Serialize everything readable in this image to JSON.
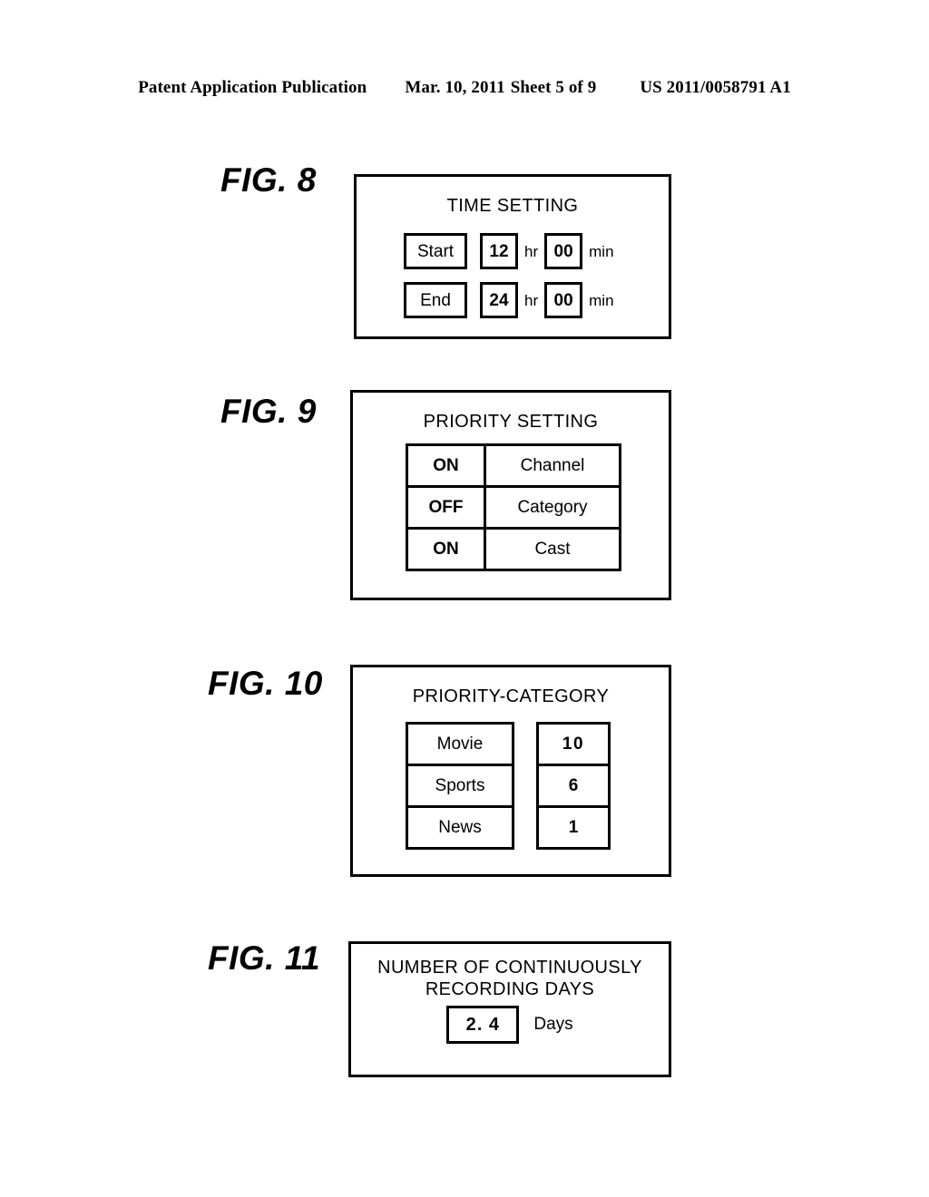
{
  "header": {
    "publication": "Patent Application Publication",
    "date": "Mar. 10, 2011",
    "sheet": "Sheet 5 of 9",
    "patent_number": "US 2011/0058791 A1"
  },
  "figures": [
    {
      "label": "FIG. 8",
      "title": "TIME SETTING",
      "rows": [
        {
          "name": "Start",
          "hour": "12",
          "hour_unit": "hr",
          "minute": "00",
          "minute_unit": "min"
        },
        {
          "name": "End",
          "hour": "24",
          "hour_unit": "hr",
          "minute": "00",
          "minute_unit": "min"
        }
      ]
    },
    {
      "label": "FIG. 9",
      "title": "PRIORITY SETTING",
      "rows": [
        {
          "state": "ON",
          "item": "Channel"
        },
        {
          "state": "OFF",
          "item": "Category"
        },
        {
          "state": "ON",
          "item": "Cast"
        }
      ]
    },
    {
      "label": "FIG. 10",
      "title": "PRIORITY-CATEGORY",
      "categories": [
        "Movie",
        "Sports",
        "News"
      ],
      "scores": [
        "10",
        "6",
        "1"
      ]
    },
    {
      "label": "FIG. 11",
      "title": "NUMBER OF CONTINUOUSLY\nRECORDING DAYS",
      "value": "2. 4",
      "unit": "Days"
    }
  ]
}
